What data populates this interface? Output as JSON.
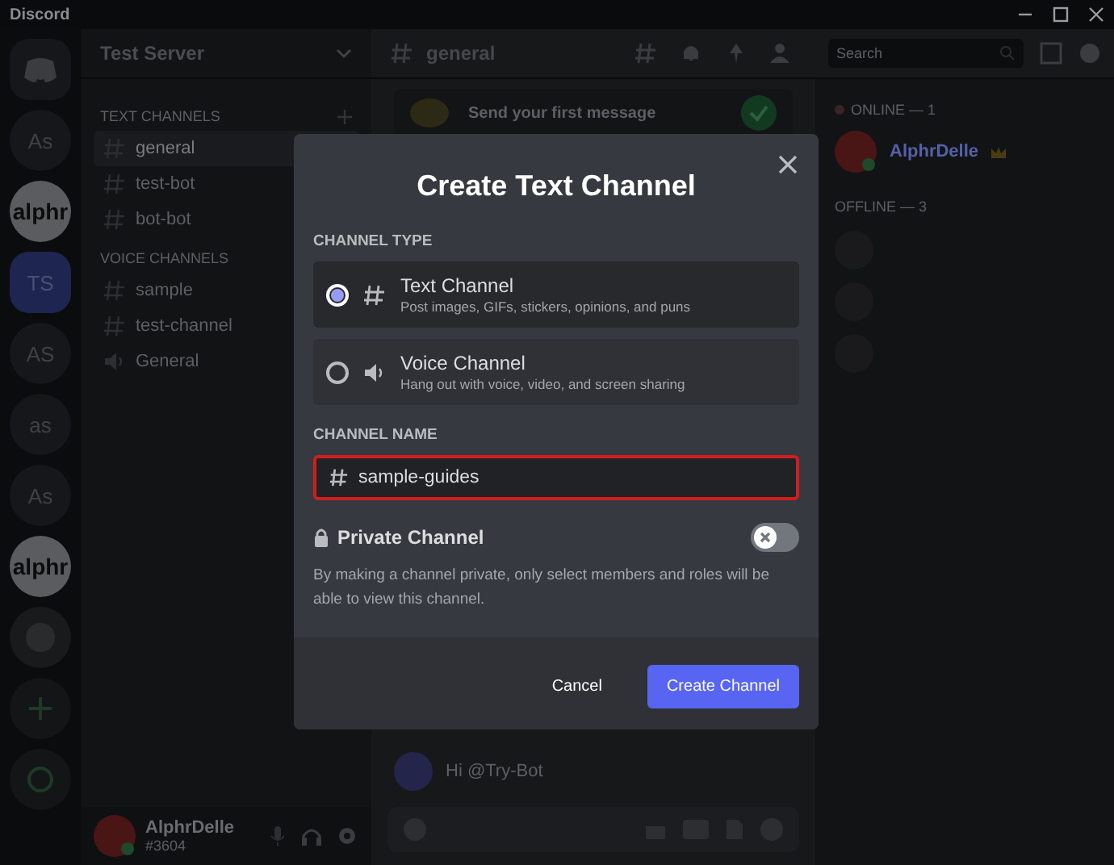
{
  "window": {
    "title": "Discord"
  },
  "servers": [
    {
      "label": "As",
      "kind": "text",
      "selected": false
    },
    {
      "label": "alphr",
      "kind": "image",
      "selected": false
    },
    {
      "label": "TS",
      "kind": "text",
      "selected": true
    },
    {
      "label": "AS",
      "kind": "text",
      "selected": false
    },
    {
      "label": "as",
      "kind": "text",
      "selected": false
    },
    {
      "label": "As",
      "kind": "text",
      "selected": false
    },
    {
      "label": "alphr",
      "kind": "image",
      "selected": false
    }
  ],
  "channel_sidebar": {
    "server_name": "Test Server",
    "categories": [
      {
        "name": "TEXT CHANNELS",
        "channels": [
          {
            "name": "general",
            "kind": "text",
            "selected": true
          },
          {
            "name": "test-bot",
            "kind": "text",
            "selected": false
          },
          {
            "name": "bot-bot",
            "kind": "text",
            "selected": false
          }
        ]
      },
      {
        "name": "VOICE CHANNELS",
        "channels": [
          {
            "name": "sample",
            "kind": "text",
            "selected": false
          },
          {
            "name": "test-channel",
            "kind": "text",
            "selected": false
          },
          {
            "name": "General",
            "kind": "voice",
            "selected": false
          }
        ]
      }
    ]
  },
  "user_panel": {
    "name": "AlphrDelle",
    "tag": "#3604"
  },
  "chat_header": {
    "channel": "general",
    "search_placeholder": "Search"
  },
  "chat": {
    "welcome_step": "Send your first message",
    "message": "Hi @Try-Bot"
  },
  "members": [
    {
      "heading": "ONLINE — 1",
      "members": [
        "AlphrDelle"
      ]
    },
    {
      "heading": "OFFLINE — 3"
    }
  ],
  "modal": {
    "title": "Create Text Channel",
    "channel_type_label": "CHANNEL TYPE",
    "channel_types": [
      {
        "kind": "text",
        "name": "Text Channel",
        "description": "Post images, GIFs, stickers, opinions, and puns",
        "selected": true
      },
      {
        "kind": "voice",
        "name": "Voice Channel",
        "description": "Hang out with voice, video, and screen sharing",
        "selected": false
      }
    ],
    "channel_name_label": "CHANNEL NAME",
    "channel_name": {
      "value": "sample-guides",
      "highlighted": true
    },
    "private": {
      "label": "Private Channel",
      "on": false,
      "description": "By making a channel private, only select members and roles will be able to view this channel."
    },
    "buttons": [
      {
        "label": "Cancel",
        "kind": "secondary"
      },
      {
        "label": "Create Channel",
        "kind": "primary"
      }
    ]
  }
}
